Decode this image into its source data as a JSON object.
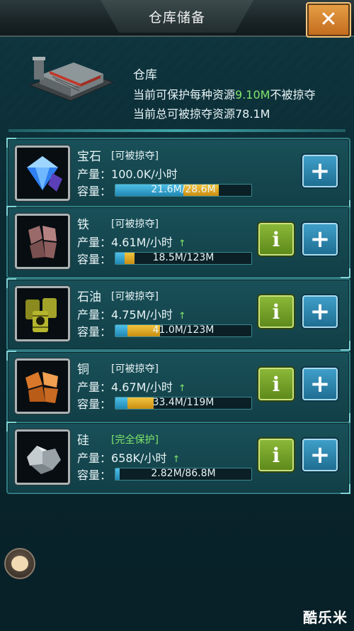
{
  "header": {
    "title": "仓库储备",
    "close_symbol": "✕"
  },
  "warehouse": {
    "name": "仓库",
    "protect_prefix": "当前可保护每种资源",
    "protect_value": "9.10M",
    "protect_suffix": "不被掠夺",
    "lootable_line": "当前总可被掠夺资源78.1M"
  },
  "labels": {
    "production": "产量：",
    "capacity": "容量："
  },
  "resources": [
    {
      "name": "宝石",
      "tag": "[可被掠夺]",
      "rate": "100.0K/小时",
      "arrow": "",
      "capacity_text": "21.6M/28.6M",
      "blue_fill": 0.5,
      "gold_fill": 0.26,
      "has_info": false
    },
    {
      "name": "铁",
      "tag": "[可被掠夺]",
      "rate": "4.61M/小时",
      "arrow": "↑",
      "capacity_text": "18.5M/123M",
      "blue_fill": 0.07,
      "gold_fill": 0.07,
      "has_info": true
    },
    {
      "name": "石油",
      "tag": "[可被掠夺]",
      "rate": "4.75M/小时",
      "arrow": "↑",
      "capacity_text": "41.0M/123M",
      "blue_fill": 0.09,
      "gold_fill": 0.24,
      "has_info": true
    },
    {
      "name": "铜",
      "tag": "[可被掠夺]",
      "rate": "4.67M/小时",
      "arrow": "↑",
      "capacity_text": "33.4M/119M",
      "blue_fill": 0.09,
      "gold_fill": 0.19,
      "has_info": true
    },
    {
      "name": "硅",
      "tag": "[完全保护]",
      "rate": "658K/小时",
      "arrow": "↑",
      "capacity_text": "2.82M/86.8M",
      "blue_fill": 0.03,
      "gold_fill": 0.0,
      "has_info": true,
      "safe": true
    }
  ],
  "buttons": {
    "info_symbol": "i",
    "plus_symbol": "+"
  },
  "watermark": "酷乐米",
  "colors": {
    "accent_green": "#7fe66a",
    "bar_blue": "#1f87b4",
    "bar_gold": "#f2c43e",
    "close_orange": "#e7a046"
  }
}
